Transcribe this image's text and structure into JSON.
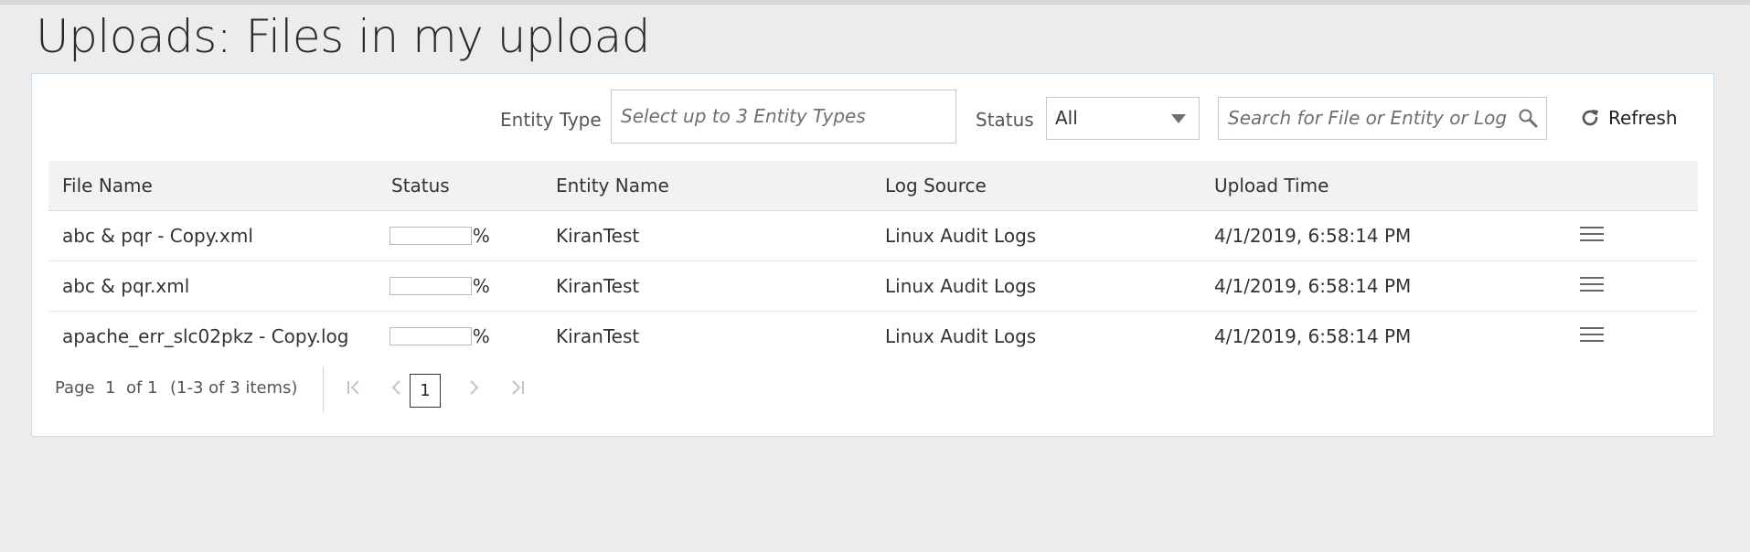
{
  "page": {
    "title": "Uploads: Files in my upload"
  },
  "filters": {
    "entity_type_label": "Entity Type",
    "entity_type_placeholder": "Select up to 3 Entity Types",
    "status_label": "Status",
    "status_value": "All",
    "search_placeholder": "Search for File or Entity or Log S...",
    "refresh_label": "Refresh"
  },
  "table": {
    "columns": [
      "File Name",
      "Status",
      "Entity Name",
      "Log Source",
      "Upload Time"
    ],
    "rows": [
      {
        "file_name": "abc & pqr - Copy.xml",
        "status_pct": "0%",
        "progress": 0,
        "entity_name": "KiranTest",
        "log_source": "Linux Audit Logs",
        "upload_time": "4/1/2019, 6:58:14 PM"
      },
      {
        "file_name": "abc & pqr.xml",
        "status_pct": "0%",
        "progress": 0,
        "entity_name": "KiranTest",
        "log_source": "Linux Audit Logs",
        "upload_time": "4/1/2019, 6:58:14 PM"
      },
      {
        "file_name": "apache_err_slc02pkz - Copy.log",
        "status_pct": "0%",
        "progress": 0,
        "entity_name": "KiranTest",
        "log_source": "Linux Audit Logs",
        "upload_time": "4/1/2019, 6:58:14 PM"
      }
    ]
  },
  "pagination": {
    "page_label": "Page",
    "page_number": "1",
    "of_label": "of 1",
    "items_label": "(1-3 of 3 items)",
    "current_page": "1"
  },
  "icons": {
    "search": "search-icon",
    "refresh": "refresh-icon",
    "row_menu": "hamburger-menu-icon",
    "first_page": "first-page-icon",
    "prev_page": "previous-page-icon",
    "next_page": "next-page-icon",
    "last_page": "last-page-icon",
    "dropdown": "chevron-down-icon"
  },
  "colors": {
    "progress_fill": "#0572ce",
    "header_bg": "#f1f2f4",
    "page_bg": "#ececec"
  }
}
